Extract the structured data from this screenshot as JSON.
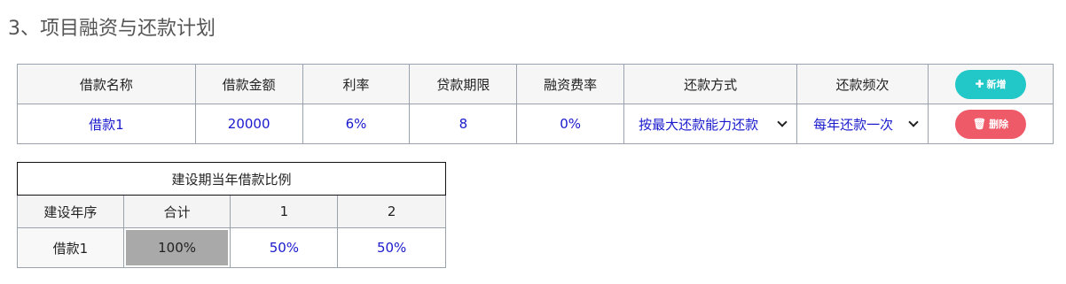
{
  "section_title": "3、项目融资与还款计划",
  "loan_table": {
    "headers": [
      "借款名称",
      "借款金额",
      "利率",
      "贷款期限",
      "融资费率",
      "还款方式",
      "还款频次"
    ],
    "add_button": {
      "icon": "plus-icon",
      "label": "新增"
    },
    "rows": [
      {
        "name": "借款1",
        "amount": "20000",
        "rate": "6%",
        "term": "8",
        "fee_rate": "0%",
        "repay_method": "按最大还款能力还款",
        "repay_freq": "每年还款一次",
        "delete_button": {
          "icon": "trash-icon",
          "label": "删除"
        }
      }
    ]
  },
  "ratio_table": {
    "caption": "建设期当年借款比例",
    "headers": [
      "建设年序",
      "合计",
      "1",
      "2"
    ],
    "rows": [
      {
        "label": "借款1",
        "total": "100%",
        "y1": "50%",
        "y2": "50%"
      }
    ]
  },
  "colors": {
    "accent_add": "#22c7c7",
    "accent_delete": "#ee5a68",
    "value_text": "#1a1acd",
    "total_cell_bg": "#a9a9a9"
  }
}
